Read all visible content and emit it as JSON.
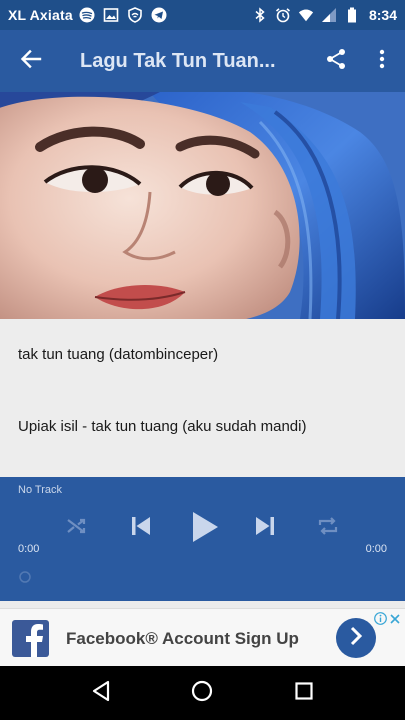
{
  "status_bar": {
    "carrier": "XL Axiata",
    "time": "8:34",
    "icons_left": [
      "spotify-icon",
      "image-icon",
      "shield-icon",
      "telegram-icon"
    ],
    "icons_right": [
      "bluetooth-icon",
      "alarm-icon",
      "wifi-icon",
      "signal-icon",
      "battery-icon"
    ]
  },
  "app_bar": {
    "title": "Lagu Tak Tun Tuan...",
    "back_icon": "arrow-left-icon",
    "share_icon": "share-icon",
    "more_icon": "more-vert-icon"
  },
  "tracks": [
    {
      "label": "tak tun tuang (datombinceper)"
    },
    {
      "label": "Upiak isil - tak tun tuang (aku sudah mandi)"
    }
  ],
  "player": {
    "now_playing": "No Track",
    "elapsed": "0:00",
    "duration": "0:00",
    "controls": [
      "shuffle-icon",
      "skip-previous-icon",
      "play-icon",
      "skip-next-icon",
      "repeat-icon"
    ]
  },
  "ad": {
    "text": "Facebook® Account Sign Up",
    "logo": "facebook-logo",
    "button_icon": "chevron-right-icon"
  },
  "nav_bar": {
    "buttons": [
      "back-triangle-icon",
      "home-circle-icon",
      "recents-square-icon"
    ]
  },
  "colors": {
    "status_bar": "#1f4f8a",
    "app_bar": "#2a5aa0",
    "player": "#2a5aa0",
    "list_bg": "#ededed"
  }
}
